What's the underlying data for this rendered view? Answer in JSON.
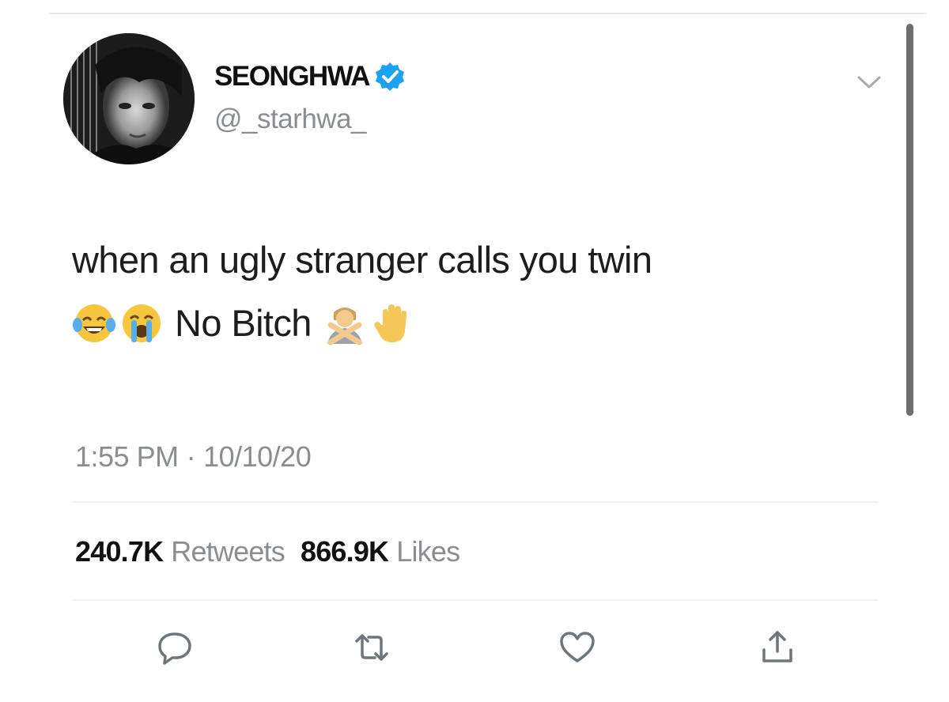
{
  "tweet": {
    "author": {
      "display_name": "SEONGHWA",
      "handle": "@_starhwa_",
      "verified": true,
      "verified_color": "#1da1f2"
    },
    "text_line1": "when an ugly stranger calls you twin",
    "text_phrase": "No Bitch",
    "emojis": [
      "face-with-tears-of-joy",
      "loudly-crying-face",
      "person-gesturing-no",
      "raised-hand"
    ],
    "time": "1:55 PM",
    "separator": "·",
    "date": "10/10/20",
    "stats": {
      "retweets_count": "240.7K",
      "retweets_label": "Retweets",
      "likes_count": "866.9K",
      "likes_label": "Likes"
    },
    "actions": [
      "reply-icon",
      "retweet-icon",
      "like-icon",
      "share-icon"
    ]
  },
  "colors": {
    "text": "#14171a",
    "secondary": "#8a8d91",
    "divider": "#eef0f1",
    "scrollbar": "#6d6e70"
  }
}
